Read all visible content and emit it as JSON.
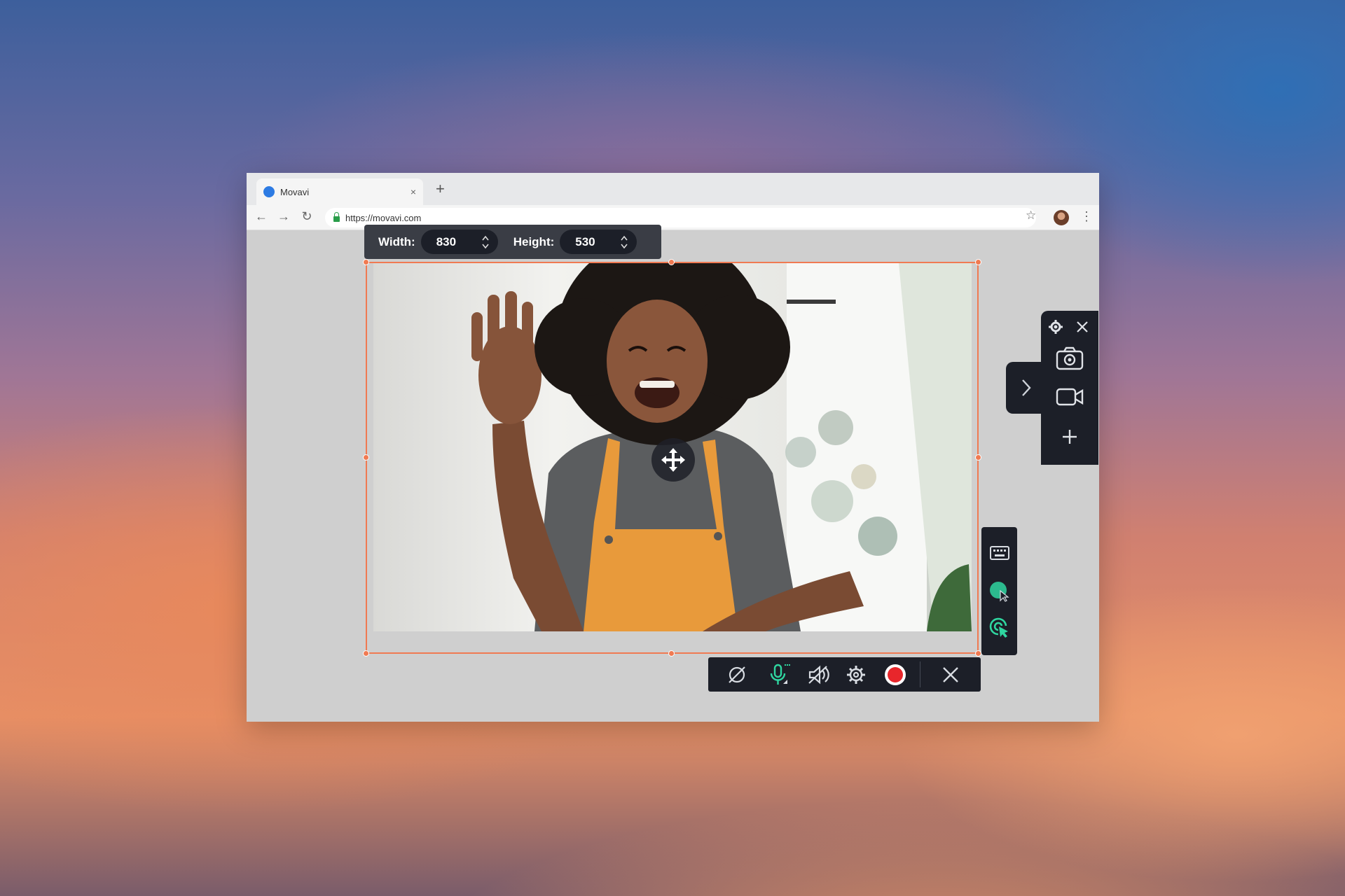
{
  "browser": {
    "tab_title": "Movavi",
    "tab_close": "×",
    "new_tab": "+",
    "url": "https://movavi.com",
    "nav": {
      "back": "←",
      "forward": "→",
      "reload": "↻"
    },
    "star": "☆",
    "menu": "⋮"
  },
  "size_panel": {
    "width_label": "Width:",
    "width_value": "830",
    "height_label": "Height:",
    "height_value": "530",
    "spinner": "⌃\n⌄"
  },
  "colors": {
    "frame_accent": "#f07a52",
    "panel_dark": "#1c1f28",
    "active_green": "#2fd6a0",
    "record_red": "#e8262b"
  },
  "widget": {
    "icons": [
      "gear-icon",
      "close-icon",
      "screenshot-camera-icon",
      "video-camera-icon",
      "plus-icon",
      "chevron-right-icon"
    ]
  },
  "side_panel": {
    "icons": [
      "keyboard-icon",
      "mouse-highlight-icon",
      "click-effect-icon"
    ]
  },
  "record_bar": {
    "icons": [
      "webcam-off-icon",
      "microphone-icon",
      "system-audio-muted-icon",
      "settings-gear-icon",
      "record-icon",
      "close-icon"
    ]
  }
}
